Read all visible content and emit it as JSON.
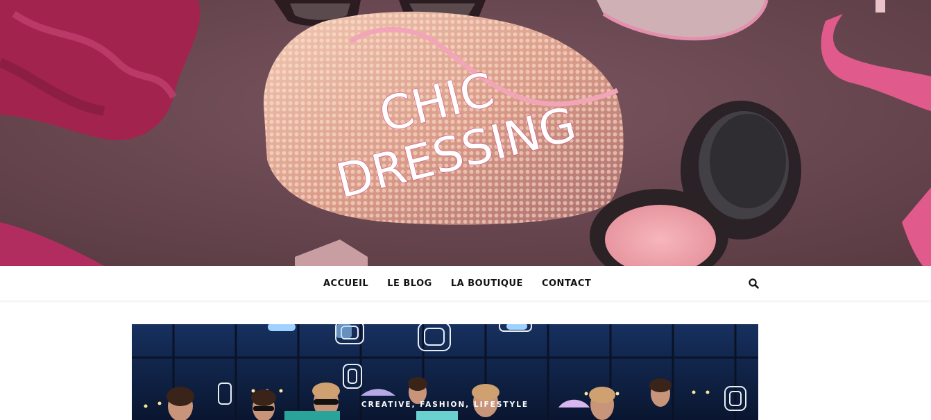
{
  "site": {
    "title_line1": "CHIC",
    "title_line2": "DRESSING"
  },
  "nav": {
    "items": [
      {
        "label": "ACCUEIL"
      },
      {
        "label": "LE BLOG"
      },
      {
        "label": "LA BOUTIQUE"
      },
      {
        "label": "CONTACT"
      }
    ],
    "search_icon": "search-icon"
  },
  "featured_post": {
    "categories": "CREATIVE, FASHION, LIFESTYLE"
  },
  "colors": {
    "hero_background": "#6b4750",
    "logo_fill": "#ffffff",
    "logo_outline": "#d0507d",
    "nav_text": "#111111"
  }
}
